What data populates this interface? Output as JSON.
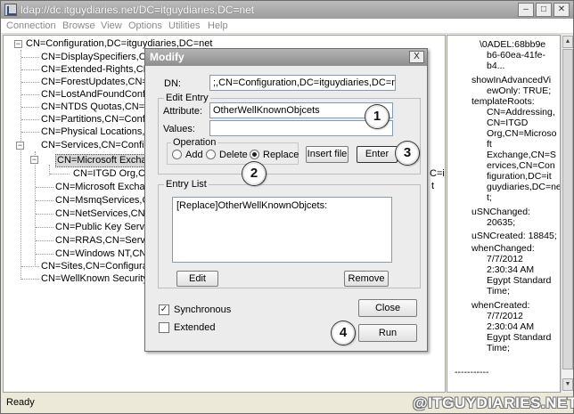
{
  "window": {
    "title": "ldap://dc.itguydiaries.net/DC=itguydiaries,DC=net",
    "minimize_glyph": "‒",
    "maximize_glyph": "□",
    "close_glyph": "✕"
  },
  "menu": [
    "Connection",
    "Browse",
    "View",
    "Options",
    "Utilities",
    "Help"
  ],
  "tree": {
    "root": "CN=Configuration,DC=itguydiaries,DC=net",
    "items": [
      "CN=DisplaySpecifiers,CN=C",
      "CN=Extended-Rights,CN=C",
      "CN=ForestUpdates,CN=Co",
      "CN=LostAndFoundConfig,C",
      "CN=NTDS Quotas,CN=Con",
      "CN=Partitions,CN=Configu",
      "CN=Physical Locations,CN",
      "CN=Services,CN=Configur",
      "CN=Microsoft Exchang",
      "CN=ITGD Org,CN=",
      "CN=Microsoft Exchang",
      "CN=MsmqServices,CN=",
      "CN=NetServices,CN=S",
      "CN=Public Key Service",
      "CN=RRAS,CN=Service",
      "CN=Windows NT,CN=S",
      "CN=Sites,CN=Configuration",
      "CN=WellKnown Security Pr"
    ],
    "overflow_text": "C=i",
    "overflow_text_2": "t",
    "collapsed_glyph": "+",
    "expanded_glyph": "−"
  },
  "details": [
    "\\0ADEL:68bb9e",
    "b6-60ea-41fe-",
    "b4...",
    "showInAdvancedVi",
    "ewOnly: TRUE;",
    "templateRoots:",
    "CN=Addressing,",
    "CN=ITGD",
    "Org,CN=Microso",
    "ft",
    "Exchange,CN=S",
    "ervices,CN=Con",
    "figuration,DC=it",
    "guydiaries,DC=ne",
    "t;",
    "uSNChanged:",
    "20635;",
    "uSNCreated: 18845;",
    "whenChanged:",
    "7/7/2012",
    "2:30:34 AM",
    "Egypt Standard",
    "Time;",
    "whenCreated:",
    "7/7/2012",
    "2:30:04 AM",
    "Egypt Standard",
    "Time;",
    "-----------"
  ],
  "status": "Ready",
  "watermark": "@ITGUYDIARIES.NET",
  "dialog": {
    "title": "Modify",
    "close_glyph": "X",
    "dn_label": "DN:",
    "dn_value": ";,CN=Configuration,DC=itguydiaries,DC=net",
    "edit_entry_label": "Edit Entry",
    "attribute_label": "Attribute:",
    "attribute_value": "OtherWellKnownObjcets",
    "values_label": "Values:",
    "values_value": "",
    "operation_label": "Operation",
    "op_add": "Add",
    "op_delete": "Delete",
    "op_replace": "Replace",
    "selected_operation": "Replace",
    "insert_file": "Insert file",
    "enter": "Enter",
    "entry_list_label": "Entry List",
    "entry_list": [
      "[Replace]OtherWellKnownObjcets:"
    ],
    "edit_button": "Edit",
    "remove_button": "Remove",
    "synchronous_label": "Synchronous",
    "synchronous_checked": true,
    "extended_label": "Extended",
    "extended_checked": false,
    "checkmark_glyph": "✓",
    "close_button": "Close",
    "run_button": "Run"
  },
  "callouts": [
    "1",
    "2",
    "3",
    "4"
  ]
}
